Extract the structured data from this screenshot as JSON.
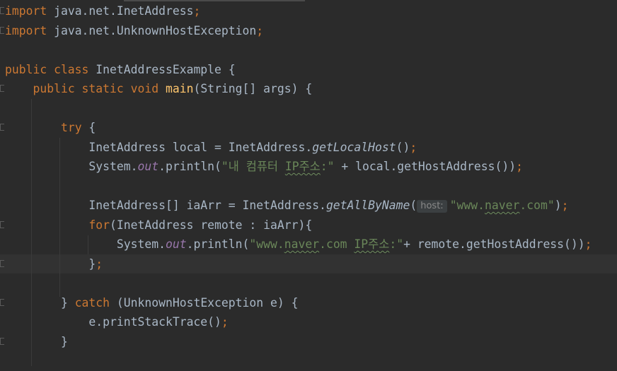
{
  "editor": {
    "lines": [
      {
        "segs": [
          {
            "t": "import",
            "c": "kw"
          },
          {
            "t": " java.net.InetAddress"
          },
          {
            "t": ";",
            "c": "kw"
          }
        ]
      },
      {
        "segs": [
          {
            "t": "import",
            "c": "kw"
          },
          {
            "t": " java.net.UnknownHostException"
          },
          {
            "t": ";",
            "c": "kw"
          }
        ]
      },
      {
        "segs": []
      },
      {
        "segs": [
          {
            "t": "public class",
            "c": "kw"
          },
          {
            "t": " InetAddressExample {"
          }
        ]
      },
      {
        "segs": [
          {
            "t": "    "
          },
          {
            "t": "public static void",
            "c": "kw"
          },
          {
            "t": " "
          },
          {
            "t": "main",
            "c": "fn"
          },
          {
            "t": "(String[] args) {"
          }
        ]
      },
      {
        "segs": []
      },
      {
        "segs": [
          {
            "t": "        "
          },
          {
            "t": "try",
            "c": "kw"
          },
          {
            "t": " {"
          }
        ]
      },
      {
        "segs": [
          {
            "t": "            InetAddress local = InetAddress."
          },
          {
            "t": "getLocalHost",
            "c": "smi"
          },
          {
            "t": "()"
          },
          {
            "t": ";",
            "c": "kw"
          }
        ]
      },
      {
        "segs": [
          {
            "t": "            System."
          },
          {
            "t": "out",
            "c": "st"
          },
          {
            "t": ".println("
          },
          {
            "t": "\"내 컴퓨터 ",
            "c": "str"
          },
          {
            "t": "IP주소",
            "c": "str squig"
          },
          {
            "t": ":\"",
            "c": "str"
          },
          {
            "t": " + local.getHostAddress())"
          },
          {
            "t": ";",
            "c": "kw"
          }
        ]
      },
      {
        "segs": []
      },
      {
        "segs": [
          {
            "t": "            InetAddress[] iaArr = InetAddress."
          },
          {
            "t": "getAllByName",
            "c": "smi"
          },
          {
            "t": "("
          },
          {
            "t": "host:",
            "c": "hint"
          },
          {
            "t": "\"www.",
            "c": "str"
          },
          {
            "t": "naver",
            "c": "str squig"
          },
          {
            "t": ".com\"",
            "c": "str"
          },
          {
            "t": ")"
          },
          {
            "t": ";",
            "c": "kw"
          }
        ]
      },
      {
        "segs": [
          {
            "t": "            "
          },
          {
            "t": "for",
            "c": "kw"
          },
          {
            "t": "(InetAddress remote : iaArr){"
          }
        ]
      },
      {
        "segs": [
          {
            "t": "                System."
          },
          {
            "t": "out",
            "c": "st"
          },
          {
            "t": ".println("
          },
          {
            "t": "\"www.",
            "c": "str"
          },
          {
            "t": "naver",
            "c": "str squig"
          },
          {
            "t": ".com ",
            "c": "str"
          },
          {
            "t": "IP주소",
            "c": "str squig"
          },
          {
            "t": ":\"",
            "c": "str"
          },
          {
            "t": "+ remote.getHostAddress())"
          },
          {
            "t": ";",
            "c": "kw"
          }
        ]
      },
      {
        "segs": [
          {
            "t": "            }"
          },
          {
            "t": ";",
            "c": "kw"
          }
        ],
        "current": true
      },
      {
        "segs": []
      },
      {
        "segs": [
          {
            "t": "        } "
          },
          {
            "t": "catch",
            "c": "kw"
          },
          {
            "t": " (UnknownHostException e) {"
          }
        ]
      },
      {
        "segs": [
          {
            "t": "            e.printStackTrace()"
          },
          {
            "t": ";",
            "c": "kw"
          }
        ]
      },
      {
        "segs": [
          {
            "t": "        }"
          }
        ]
      },
      {
        "segs": []
      }
    ]
  }
}
